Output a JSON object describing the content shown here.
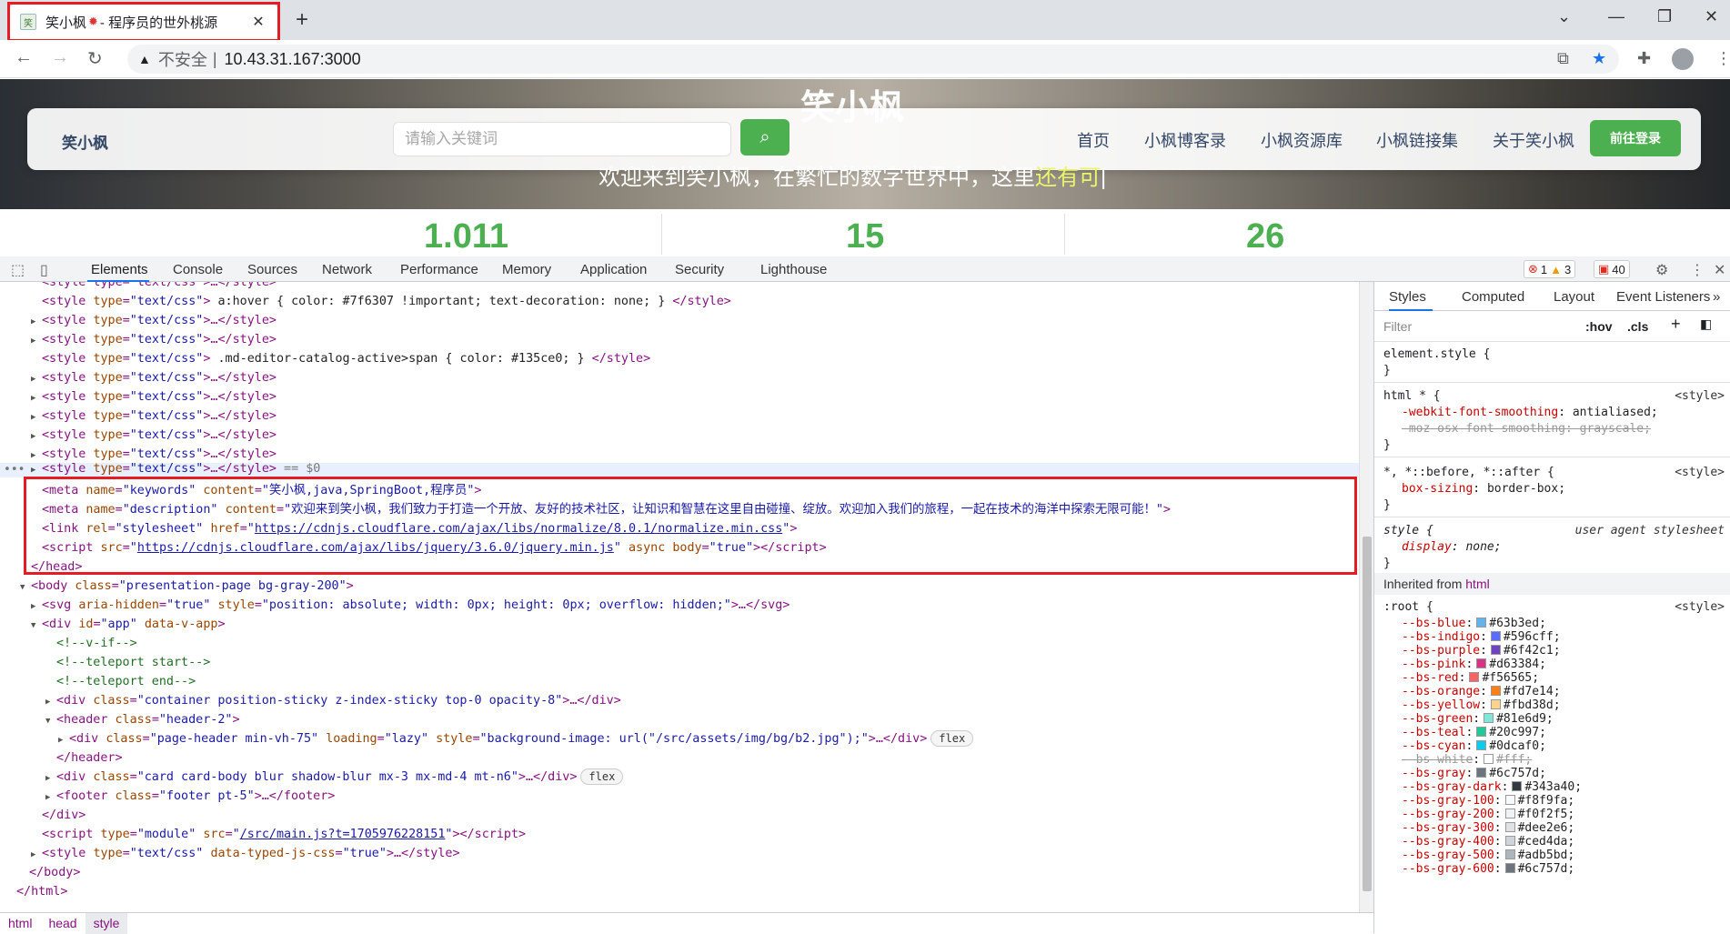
{
  "browser": {
    "tab_title": "笑小枫",
    "tab_title_suffix": " - 程序员的世外桃源",
    "favicon_text": "笑",
    "insecure_label": "不安全",
    "separator": "|",
    "url": "10.43.31.167:3000"
  },
  "site": {
    "hero_title": "笑小枫",
    "brand": "笑小枫",
    "search_placeholder": "请输入关键词",
    "nav": [
      "首页",
      "小枫博客录",
      "小枫资源库",
      "小枫链接集",
      "关于笑小枫"
    ],
    "login": "前往登录",
    "welcome_main": "欢迎来到笑小枫，在繁忙的数字世界中，这里",
    "welcome_highlight": "还有可",
    "welcome_cursor": "|",
    "stats": [
      "1.011",
      "15",
      "26"
    ]
  },
  "devtools": {
    "tabs": [
      "Elements",
      "Console",
      "Sources",
      "Network",
      "Performance",
      "Memory",
      "Application",
      "Security",
      "Lighthouse"
    ],
    "errors": "1",
    "warnings": "3",
    "issues": "40",
    "breadcrumbs": [
      "html",
      "head",
      "style"
    ],
    "styles_tabs": [
      "Styles",
      "Computed",
      "Layout",
      "Event Listeners"
    ],
    "filter_placeholder": "Filter",
    "hov": ":hov",
    "cls": ".cls",
    "dom": {
      "l0": "<style type=\"text/css\">…</style>",
      "l1_text": " a:hover { color: #7f6307 !important; text-decoration: none; } ",
      "style_open": "<style",
      "type_attr": "type",
      "type_val": "\"text/css\"",
      "collapsed": ">…</style>",
      "l3_text": " .md-editor-catalog-active>span { color: #135ce0; } ",
      "style_close": "</style>",
      "eq0": " == $0",
      "meta_kw_content": "\"笑小枫,java,SpringBoot,程序员\"",
      "meta_desc_content": "\"欢迎来到笑小枫，我们致力于打造一个开放、友好的技术社区，让知识和智慧在这里自由碰撞、绽放。欢迎加入我们的旅程，一起在技术的海洋中探索无限可能！\"",
      "link_href": "https://cdnjs.cloudflare.com/ajax/libs/normalize/8.0.1/normalize.min.css",
      "script_src": "https://cdnjs.cloudflare.com/ajax/libs/jquery/3.6.0/jquery.min.js",
      "head_close": "</head>",
      "body_class": "\"presentation-page bg-gray-200\"",
      "svg_style": "\"position: absolute; width: 0px; height: 0px; overflow: hidden;\"",
      "comment_vif": "<!--v-if-->",
      "comment_tp_start": "<!--teleport start-->",
      "comment_tp_end": "<!--teleport end-->",
      "div_container_class": "\"container position-sticky z-index-sticky top-0 opacity-8\"",
      "header_class": "\"header-2\"",
      "page_header_class": "\"page-header min-vh-75\"",
      "page_header_style": "\"background-image: url(\"/src/assets/img/bg/b2.jpg\");\"",
      "flex": "flex",
      "header_close": "</header>",
      "card_class": "\"card card-body blur shadow-blur mx-3 mx-md-4 mt-n6\"",
      "footer_class": "\"footer pt-5\"",
      "div_close": "</div>",
      "main_src": "/src/main.js?t=1705976228151",
      "typed_css": "\"true\"",
      "body_close": "</body>",
      "html_close": "</html>"
    },
    "styles": {
      "element_style": "element.style {",
      "html_star": "html * {",
      "origin_style": "<style>",
      "webkit_prop": "-webkit-font-smoothing",
      "webkit_val": "antialiased;",
      "moz_prop": "-moz-osx-font-smoothing",
      "moz_val": "grayscale;",
      "star_sel": "*, *::before, *::after {",
      "bs_prop": "box-sizing",
      "bs_val": "border-box;",
      "style_sel": "style {",
      "ua_origin": "user agent stylesheet",
      "display_prop": "display",
      "display_val": "none;",
      "inherited_from": "Inherited from",
      "inherited_tag": "html",
      "root_sel": ":root {",
      "vars": [
        {
          "name": "--bs-blue",
          "value": "#63b3ed",
          "color": "#63b3ed",
          "strike": false
        },
        {
          "name": "--bs-indigo",
          "value": "#596cff",
          "color": "#596cff",
          "strike": false
        },
        {
          "name": "--bs-purple",
          "value": "#6f42c1",
          "color": "#6f42c1",
          "strike": false
        },
        {
          "name": "--bs-pink",
          "value": "#d63384",
          "color": "#d63384",
          "strike": false
        },
        {
          "name": "--bs-red",
          "value": "#f56565",
          "color": "#f56565",
          "strike": false
        },
        {
          "name": "--bs-orange",
          "value": "#fd7e14",
          "color": "#fd7e14",
          "strike": false
        },
        {
          "name": "--bs-yellow",
          "value": "#fbd38d",
          "color": "#fbd38d",
          "strike": false
        },
        {
          "name": "--bs-green",
          "value": "#81e6d9",
          "color": "#81e6d9",
          "strike": false
        },
        {
          "name": "--bs-teal",
          "value": "#20c997",
          "color": "#20c997",
          "strike": false
        },
        {
          "name": "--bs-cyan",
          "value": "#0dcaf0",
          "color": "#0dcaf0",
          "strike": false
        },
        {
          "name": "--bs-white",
          "value": "#fff",
          "color": "#ffffff",
          "strike": true
        },
        {
          "name": "--bs-gray",
          "value": "#6c757d",
          "color": "#6c757d",
          "strike": false
        },
        {
          "name": "--bs-gray-dark",
          "value": "#343a40",
          "color": "#343a40",
          "strike": false
        },
        {
          "name": "--bs-gray-100",
          "value": "#f8f9fa",
          "color": "#f8f9fa",
          "strike": false
        },
        {
          "name": "--bs-gray-200",
          "value": "#f0f2f5",
          "color": "#f0f2f5",
          "strike": false
        },
        {
          "name": "--bs-gray-300",
          "value": "#dee2e6",
          "color": "#dee2e6",
          "strike": false
        },
        {
          "name": "--bs-gray-400",
          "value": "#ced4da",
          "color": "#ced4da",
          "strike": false
        },
        {
          "name": "--bs-gray-500",
          "value": "#adb5bd",
          "color": "#adb5bd",
          "strike": false
        },
        {
          "name": "--bs-gray-600",
          "value": "#6c757d",
          "color": "#6c757d",
          "strike": false
        }
      ]
    }
  },
  "colors": {
    "highlight_red": "#e51c23",
    "accent_green": "#4caf50",
    "devtools_blue": "#1a73e8"
  }
}
